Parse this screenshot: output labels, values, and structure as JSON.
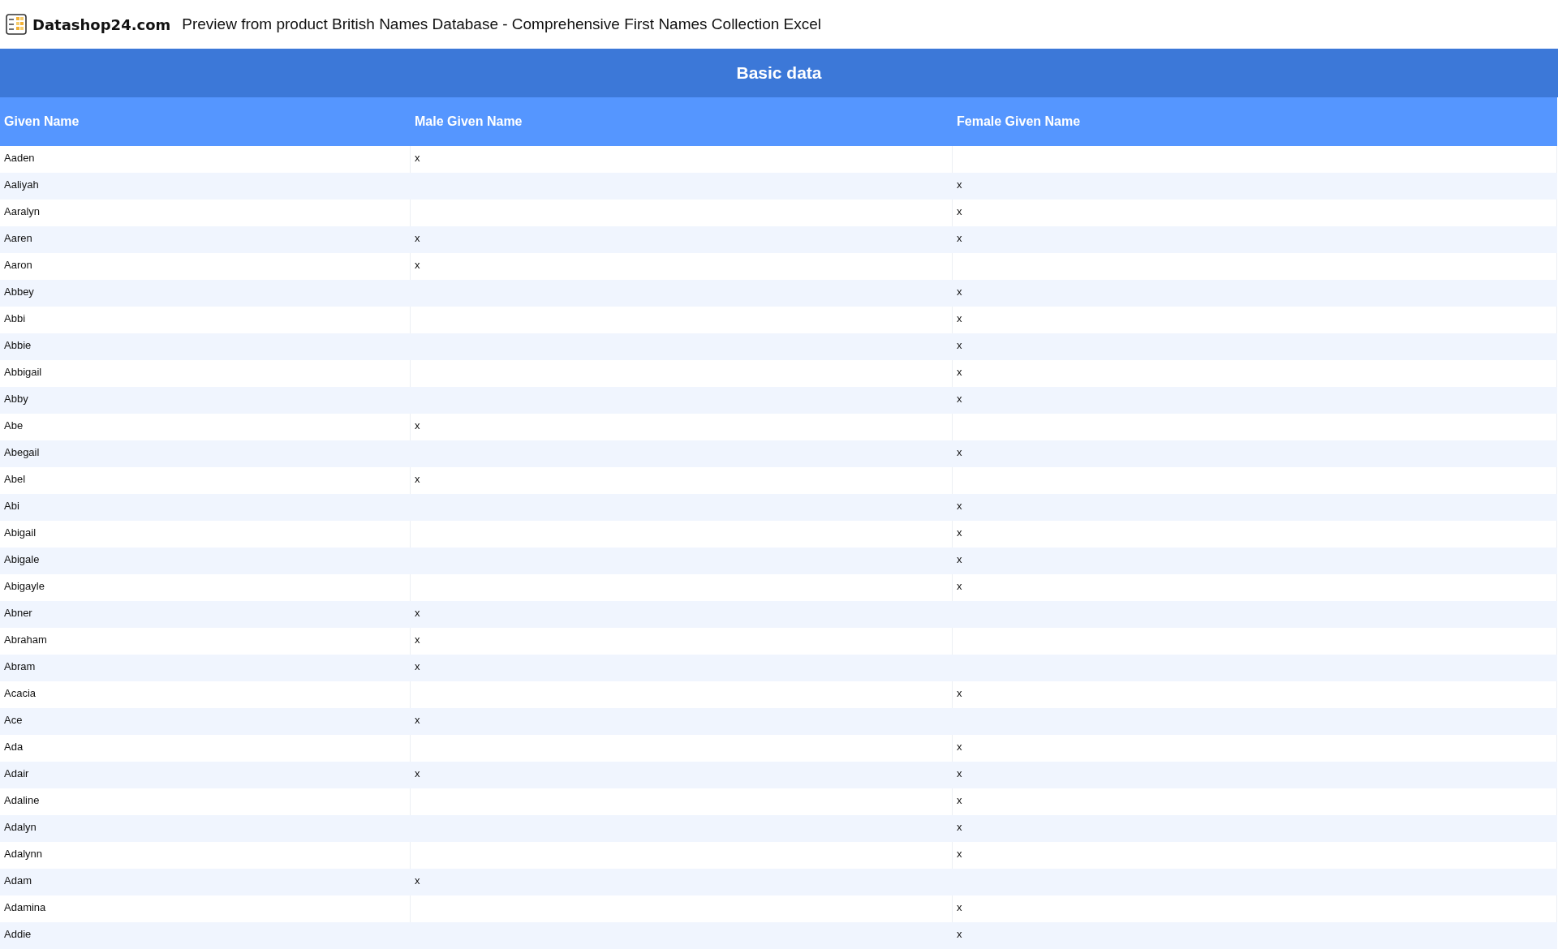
{
  "header": {
    "logo_text": "Datashop24.com",
    "title": "Preview from product British Names Database - Comprehensive First Names Collection Excel"
  },
  "table": {
    "group_title": "Basic data",
    "columns": [
      "Given Name",
      "Male Given Name",
      "Female Given Name"
    ],
    "rows": [
      {
        "given": "Aaden",
        "male": "x"
      },
      {
        "given": "Aaliyah",
        "female": "x"
      },
      {
        "given": "Aaralyn",
        "female": "x"
      },
      {
        "given": "Aaren",
        "male": "x",
        "female": "x"
      },
      {
        "given": "Aaron",
        "male": "x"
      },
      {
        "given": "Abbey",
        "female": "x"
      },
      {
        "given": "Abbi",
        "female": "x"
      },
      {
        "given": "Abbie",
        "female": "x"
      },
      {
        "given": "Abbigail",
        "female": "x"
      },
      {
        "given": "Abby",
        "female": "x"
      },
      {
        "given": "Abe",
        "male": "x"
      },
      {
        "given": "Abegail",
        "female": "x"
      },
      {
        "given": "Abel",
        "male": "x"
      },
      {
        "given": "Abi",
        "female": "x"
      },
      {
        "given": "Abigail",
        "female": "x"
      },
      {
        "given": "Abigale",
        "female": "x"
      },
      {
        "given": "Abigayle",
        "female": "x"
      },
      {
        "given": "Abner",
        "male": "x"
      },
      {
        "given": "Abraham",
        "male": "x"
      },
      {
        "given": "Abram",
        "male": "x"
      },
      {
        "given": "Acacia",
        "female": "x"
      },
      {
        "given": "Ace",
        "male": "x"
      },
      {
        "given": "Ada",
        "female": "x"
      },
      {
        "given": "Adair",
        "male": "x",
        "female": "x"
      },
      {
        "given": "Adaline",
        "female": "x"
      },
      {
        "given": "Adalyn",
        "female": "x"
      },
      {
        "given": "Adalynn",
        "female": "x"
      },
      {
        "given": "Adam",
        "male": "x"
      },
      {
        "given": "Adamina",
        "female": "x"
      },
      {
        "given": "Addie",
        "female": "x"
      }
    ]
  }
}
